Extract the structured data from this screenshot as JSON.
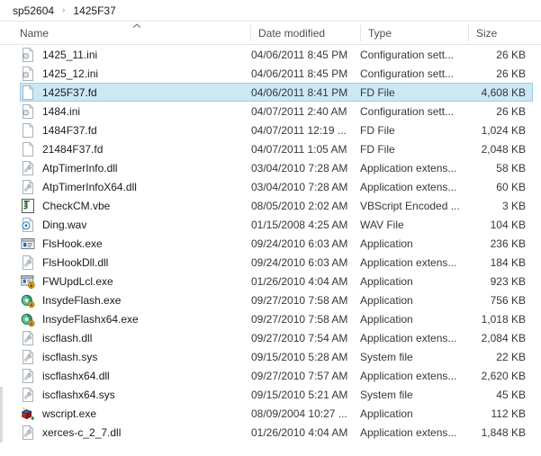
{
  "breadcrumb": {
    "items": [
      "sp52604",
      "1425F37"
    ],
    "separator": "›"
  },
  "columns": {
    "name": "Name",
    "date_modified": "Date modified",
    "type": "Type",
    "size": "Size",
    "sort_column": "Name",
    "sort_direction": "ascending",
    "sort_icon": "chevron-up-icon"
  },
  "colors": {
    "selection_fill": "#cce8f4",
    "selection_border": "#99d1ec",
    "divider": "#e2e5e8",
    "header_text": "#4a5056",
    "body_text": "#1a1a1a"
  },
  "files": [
    {
      "name": "1425_11.ini",
      "date": "04/06/2011 8:45 PM",
      "type": "Configuration sett...",
      "size": "26 KB",
      "icon": "ini-config-file-icon",
      "selected": false
    },
    {
      "name": "1425_12.ini",
      "date": "04/06/2011 8:45 PM",
      "type": "Configuration sett...",
      "size": "26 KB",
      "icon": "ini-config-file-icon",
      "selected": false
    },
    {
      "name": "1425F37.fd",
      "date": "04/06/2011 8:41 PM",
      "type": "FD File",
      "size": "4,608 KB",
      "icon": "blank-file-icon",
      "selected": true
    },
    {
      "name": "1484.ini",
      "date": "04/07/2011 2:40 AM",
      "type": "Configuration sett...",
      "size": "26 KB",
      "icon": "ini-config-file-icon",
      "selected": false
    },
    {
      "name": "1484F37.fd",
      "date": "04/07/2011 12:19 ...",
      "type": "FD File",
      "size": "1,024 KB",
      "icon": "blank-file-icon",
      "selected": false
    },
    {
      "name": "21484F37.fd",
      "date": "04/07/2011 1:05 AM",
      "type": "FD File",
      "size": "2,048 KB",
      "icon": "blank-file-icon",
      "selected": false
    },
    {
      "name": "AtpTimerInfo.dll",
      "date": "03/04/2010 7:28 AM",
      "type": "Application extens...",
      "size": "58 KB",
      "icon": "dll-file-icon",
      "selected": false
    },
    {
      "name": "AtpTimerInfoX64.dll",
      "date": "03/04/2010 7:28 AM",
      "type": "Application extens...",
      "size": "60 KB",
      "icon": "dll-file-icon",
      "selected": false
    },
    {
      "name": "CheckCM.vbe",
      "date": "08/05/2010 2:02 AM",
      "type": "VBScript Encoded ...",
      "size": "3 KB",
      "icon": "vbscript-file-icon",
      "selected": false
    },
    {
      "name": "Ding.wav",
      "date": "01/15/2008 4:25 AM",
      "type": "WAV File",
      "size": "104 KB",
      "icon": "wav-audio-file-icon",
      "selected": false
    },
    {
      "name": "FlsHook.exe",
      "date": "09/24/2010 6:03 AM",
      "type": "Application",
      "size": "236 KB",
      "icon": "application-window-icon",
      "selected": false
    },
    {
      "name": "FlsHookDll.dll",
      "date": "09/24/2010 6:03 AM",
      "type": "Application extens...",
      "size": "184 KB",
      "icon": "dll-file-icon",
      "selected": false
    },
    {
      "name": "FWUpdLcl.exe",
      "date": "01/26/2010 4:04 AM",
      "type": "Application",
      "size": "923 KB",
      "icon": "application-badge-icon",
      "selected": false
    },
    {
      "name": "InsydeFlash.exe",
      "date": "09/27/2010 7:58 AM",
      "type": "Application",
      "size": "756 KB",
      "icon": "insyde-flash-icon",
      "selected": false
    },
    {
      "name": "InsydeFlashx64.exe",
      "date": "09/27/2010 7:58 AM",
      "type": "Application",
      "size": "1,018 KB",
      "icon": "insyde-flash-icon",
      "selected": false
    },
    {
      "name": "iscflash.dll",
      "date": "09/27/2010 7:54 AM",
      "type": "Application extens...",
      "size": "2,084 KB",
      "icon": "dll-file-icon",
      "selected": false
    },
    {
      "name": "iscflash.sys",
      "date": "09/15/2010 5:28 AM",
      "type": "System file",
      "size": "22 KB",
      "icon": "dll-file-icon",
      "selected": false
    },
    {
      "name": "iscflashx64.dll",
      "date": "09/27/2010 7:57 AM",
      "type": "Application extens...",
      "size": "2,620 KB",
      "icon": "dll-file-icon",
      "selected": false
    },
    {
      "name": "iscflashx64.sys",
      "date": "09/15/2010 5:21 AM",
      "type": "System file",
      "size": "45 KB",
      "icon": "dll-file-icon",
      "selected": false
    },
    {
      "name": "wscript.exe",
      "date": "08/09/2004 10:27 ...",
      "type": "Application",
      "size": "112 KB",
      "icon": "wscript-cube-icon",
      "selected": false
    },
    {
      "name": "xerces-c_2_7.dll",
      "date": "01/26/2010 4:04 AM",
      "type": "Application extens...",
      "size": "1,848 KB",
      "icon": "dll-file-icon",
      "selected": false
    }
  ]
}
